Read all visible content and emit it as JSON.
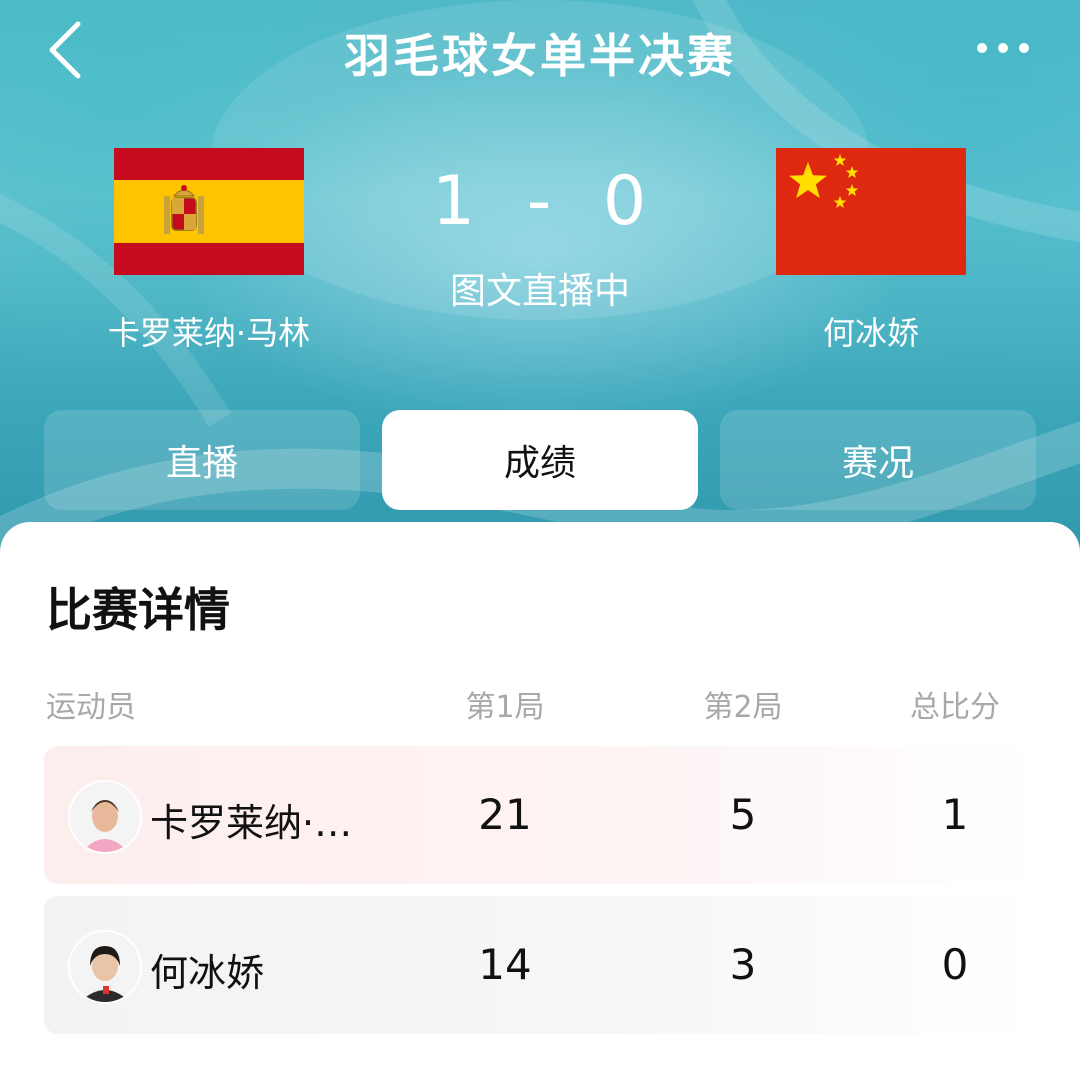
{
  "header": {
    "title": "羽毛球女单半决赛",
    "back_icon": "chevron-left-icon",
    "more_icon": "more-dots-icon"
  },
  "match": {
    "left_player": "卡罗莱纳·马林",
    "right_player": "何冰娇",
    "left_flag": "spain-flag",
    "right_flag": "china-flag",
    "score_left": "1",
    "score_sep": "-",
    "score_right": "0",
    "status": "图文直播中"
  },
  "tabs": [
    {
      "label": "直播",
      "active": false
    },
    {
      "label": "成绩",
      "active": true
    },
    {
      "label": "赛况",
      "active": false
    }
  ],
  "details": {
    "title": "比赛详情",
    "columns": [
      "运动员",
      "第1局",
      "第2局",
      "总比分"
    ],
    "rows": [
      {
        "name": "卡罗莱纳·…",
        "game1": "21",
        "game2": "5",
        "total": "1"
      },
      {
        "name": "何冰娇",
        "game1": "14",
        "game2": "3",
        "total": "0"
      }
    ]
  },
  "colors": {
    "header_teal": "#4fb9c8",
    "spain_red": "#c60b1e",
    "spain_yellow": "#ffc400",
    "china_red": "#de2910",
    "china_yellow": "#ffde00",
    "row_highlight": "#fdeeee"
  }
}
